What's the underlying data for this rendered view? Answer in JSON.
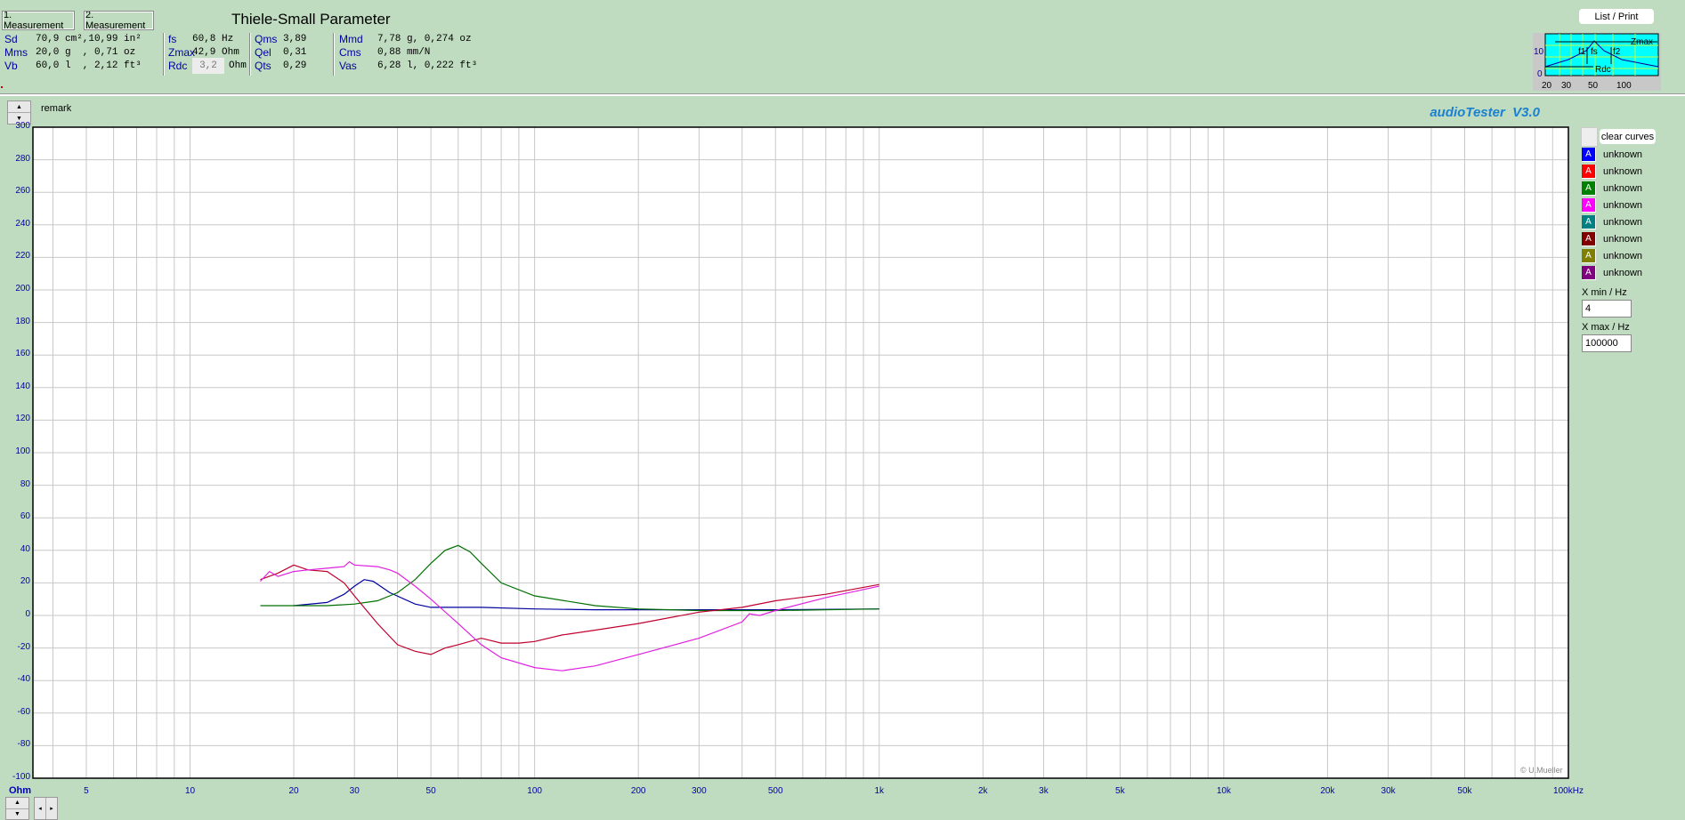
{
  "header": {
    "measurement1": "1. Measurement",
    "measurement2": "2. Measurement",
    "title": "Thiele-Small Parameter",
    "list_print": "List / Print",
    "remark": "remark",
    "app_title": "audioTester  V3.0"
  },
  "params": {
    "col1": [
      {
        "label": "Sd",
        "value": "70,9 cm²,10,99 in²"
      },
      {
        "label": "Mms",
        "value": "20,0 g  , 0,71 oz"
      },
      {
        "label": "Vb",
        "value": "60,0 l  , 2,12 ft³"
      }
    ],
    "col2": [
      {
        "label": "fs",
        "value": "60,8 Hz"
      },
      {
        "label": "Zmax",
        "value": "42,9 Ohm"
      },
      {
        "label": "Rdc",
        "value": "3,2",
        "unit": "Ohm"
      }
    ],
    "col3": [
      {
        "label": "Qms",
        "value": "3,89"
      },
      {
        "label": "Qel",
        "value": "0,31"
      },
      {
        "label": "Qts",
        "value": "0,29"
      }
    ],
    "col4": [
      {
        "label": "Mmd",
        "value": "7,78 g, 0,274 oz"
      },
      {
        "label": "Cms",
        "value": "0,88 mm/N"
      },
      {
        "label": "Vas",
        "value": "6,28 l, 0,222 ft³"
      }
    ]
  },
  "mini_graph": {
    "labels": [
      "Zmax",
      "f1",
      "fs",
      "f2",
      "Rdc"
    ],
    "y_ticks": [
      "10",
      "0"
    ],
    "x_ticks": [
      "20",
      "30",
      "50",
      "100"
    ]
  },
  "legend": {
    "clear": "clear curves",
    "items": [
      {
        "icon": "A",
        "label": "unknown",
        "color": "#0000ff"
      },
      {
        "icon": "A",
        "label": "unknown",
        "color": "#ff0000"
      },
      {
        "icon": "A",
        "label": "unknown",
        "color": "#008000"
      },
      {
        "icon": "A",
        "label": "unknown",
        "color": "#ff00ff"
      },
      {
        "icon": "A",
        "label": "unknown",
        "color": "#008080"
      },
      {
        "icon": "A",
        "label": "unknown",
        "color": "#800000"
      },
      {
        "icon": "A",
        "label": "unknown",
        "color": "#808000"
      },
      {
        "icon": "A",
        "label": "unknown",
        "color": "#800080"
      }
    ]
  },
  "xmin_label": "X min / Hz",
  "xmin_value": "4",
  "xmax_label": "X max / Hz",
  "xmax_value": "100000",
  "copyright": "© U.Mueller",
  "chart_data": {
    "type": "line",
    "xscale": "log",
    "xlim": [
      3.5,
      100000
    ],
    "ylim": [
      -100,
      300
    ],
    "ylabel": "Ohm",
    "grid": true,
    "y_ticks": [
      "300",
      "280",
      "260",
      "240",
      "220",
      "200",
      "180",
      "160",
      "140",
      "120",
      "100",
      "80",
      "60",
      "40",
      "20",
      "0",
      "-20",
      "-40",
      "-60",
      "-80",
      "-100"
    ],
    "x_ticks": [
      {
        "v": 5,
        "t": "5"
      },
      {
        "v": 10,
        "t": "10"
      },
      {
        "v": 20,
        "t": "20"
      },
      {
        "v": 30,
        "t": "30"
      },
      {
        "v": 50,
        "t": "50"
      },
      {
        "v": 100,
        "t": "100"
      },
      {
        "v": 200,
        "t": "200"
      },
      {
        "v": 300,
        "t": "300"
      },
      {
        "v": 500,
        "t": "500"
      },
      {
        "v": 1000,
        "t": "1k"
      },
      {
        "v": 2000,
        "t": "2k"
      },
      {
        "v": 3000,
        "t": "3k"
      },
      {
        "v": 5000,
        "t": "5k"
      },
      {
        "v": 10000,
        "t": "10k"
      },
      {
        "v": 20000,
        "t": "20k"
      },
      {
        "v": 30000,
        "t": "30k"
      },
      {
        "v": 50000,
        "t": "50k"
      },
      {
        "v": 100000,
        "t": "100kHz"
      }
    ],
    "series": [
      {
        "name": "blue",
        "color": "#0000a0",
        "x": [
          20,
          25,
          28,
          30,
          32,
          34,
          38,
          45,
          50,
          70,
          100,
          150,
          200,
          500,
          1000
        ],
        "y": [
          6,
          8,
          13,
          18,
          22,
          21,
          14,
          7,
          5,
          5,
          4,
          3.5,
          3.5,
          3.5,
          4
        ]
      },
      {
        "name": "green",
        "color": "#007000",
        "x": [
          16,
          25,
          30,
          35,
          40,
          45,
          50,
          55,
          60,
          65,
          70,
          80,
          100,
          150,
          200,
          300,
          500,
          1000
        ],
        "y": [
          6,
          6,
          7,
          9,
          14,
          22,
          32,
          40,
          43,
          39,
          32,
          20,
          12,
          6,
          4,
          3,
          3,
          4
        ]
      },
      {
        "name": "red",
        "color": "#c00030",
        "x": [
          16,
          18,
          20,
          22,
          25,
          28,
          30,
          35,
          40,
          45,
          50,
          55,
          60,
          70,
          80,
          90,
          100,
          120,
          150,
          200,
          300,
          400,
          500,
          700,
          1000
        ],
        "y": [
          22,
          26,
          31,
          28,
          27,
          20,
          12,
          -5,
          -18,
          -22,
          -24,
          -20,
          -18,
          -14,
          -17,
          -17,
          -16,
          -12,
          -9,
          -5,
          2,
          5,
          9,
          13,
          19
        ]
      },
      {
        "name": "magenta",
        "color": "#e020e0",
        "x": [
          16,
          17,
          18,
          20,
          22,
          25,
          28,
          29,
          30,
          35,
          38,
          40,
          45,
          50,
          60,
          70,
          80,
          100,
          120,
          150,
          200,
          300,
          400,
          420,
          450,
          500,
          700,
          1000
        ],
        "y": [
          21,
          27,
          24,
          27,
          28,
          29,
          30,
          33,
          31,
          30,
          28,
          26,
          18,
          10,
          -5,
          -18,
          -26,
          -32,
          -34,
          -31,
          -24,
          -14,
          -4,
          1,
          0,
          3,
          11,
          18
        ]
      }
    ]
  }
}
